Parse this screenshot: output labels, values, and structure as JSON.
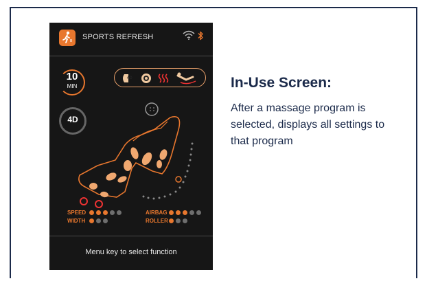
{
  "device": {
    "program_title": "SPORTS REFRESH",
    "timer": {
      "value": "10",
      "unit": "MIN"
    },
    "mode_badge": "4D",
    "features": [
      "4D",
      "foot-roller",
      "heat",
      "zero-gravity"
    ],
    "settings": {
      "speed": {
        "label": "SPEED",
        "level": 3,
        "max": 5
      },
      "width": {
        "label": "WIDTH",
        "level": 1,
        "max": 3
      },
      "airbag": {
        "label": "AIRBAG",
        "level": 3,
        "max": 5
      },
      "roller": {
        "label": "ROLLER",
        "level": 1,
        "max": 3
      }
    },
    "footer": "Menu key to select function",
    "icons": {
      "mode": "sports-figure-icon",
      "wifi": "wifi-icon",
      "bluetooth": "bluetooth-icon",
      "timer": "timer-icon",
      "chair": "massage-chair-icon"
    }
  },
  "info": {
    "heading": "In-Use Screen:",
    "description": "After a massage program is selected, displays all settings to that program"
  },
  "colors": {
    "accent": "#e8772e",
    "navy": "#1b2a4a",
    "device_bg": "#161616"
  }
}
